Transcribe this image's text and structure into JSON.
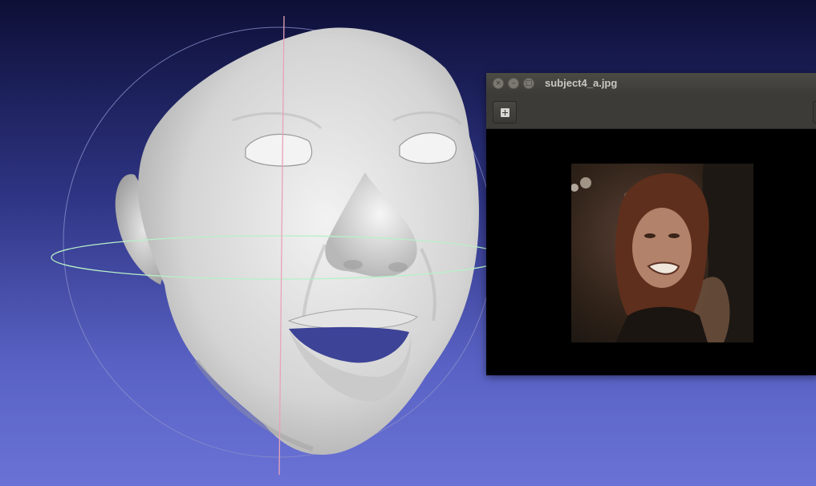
{
  "viewer": {
    "background_top": "#0d0f36",
    "background_bottom": "#6a72d6",
    "trackball_vertical_color": "#e8a3b8",
    "trackball_horizontal_color": "#b8f0c8",
    "trackball_outline_color": "#8a8fc9",
    "model_color": "#d9d9d9"
  },
  "image_window": {
    "title": "subject4_a.jpg",
    "buttons": [
      "close-icon",
      "minimize-icon",
      "maximize-icon"
    ],
    "toolbar_button_icon": "add-icon"
  }
}
